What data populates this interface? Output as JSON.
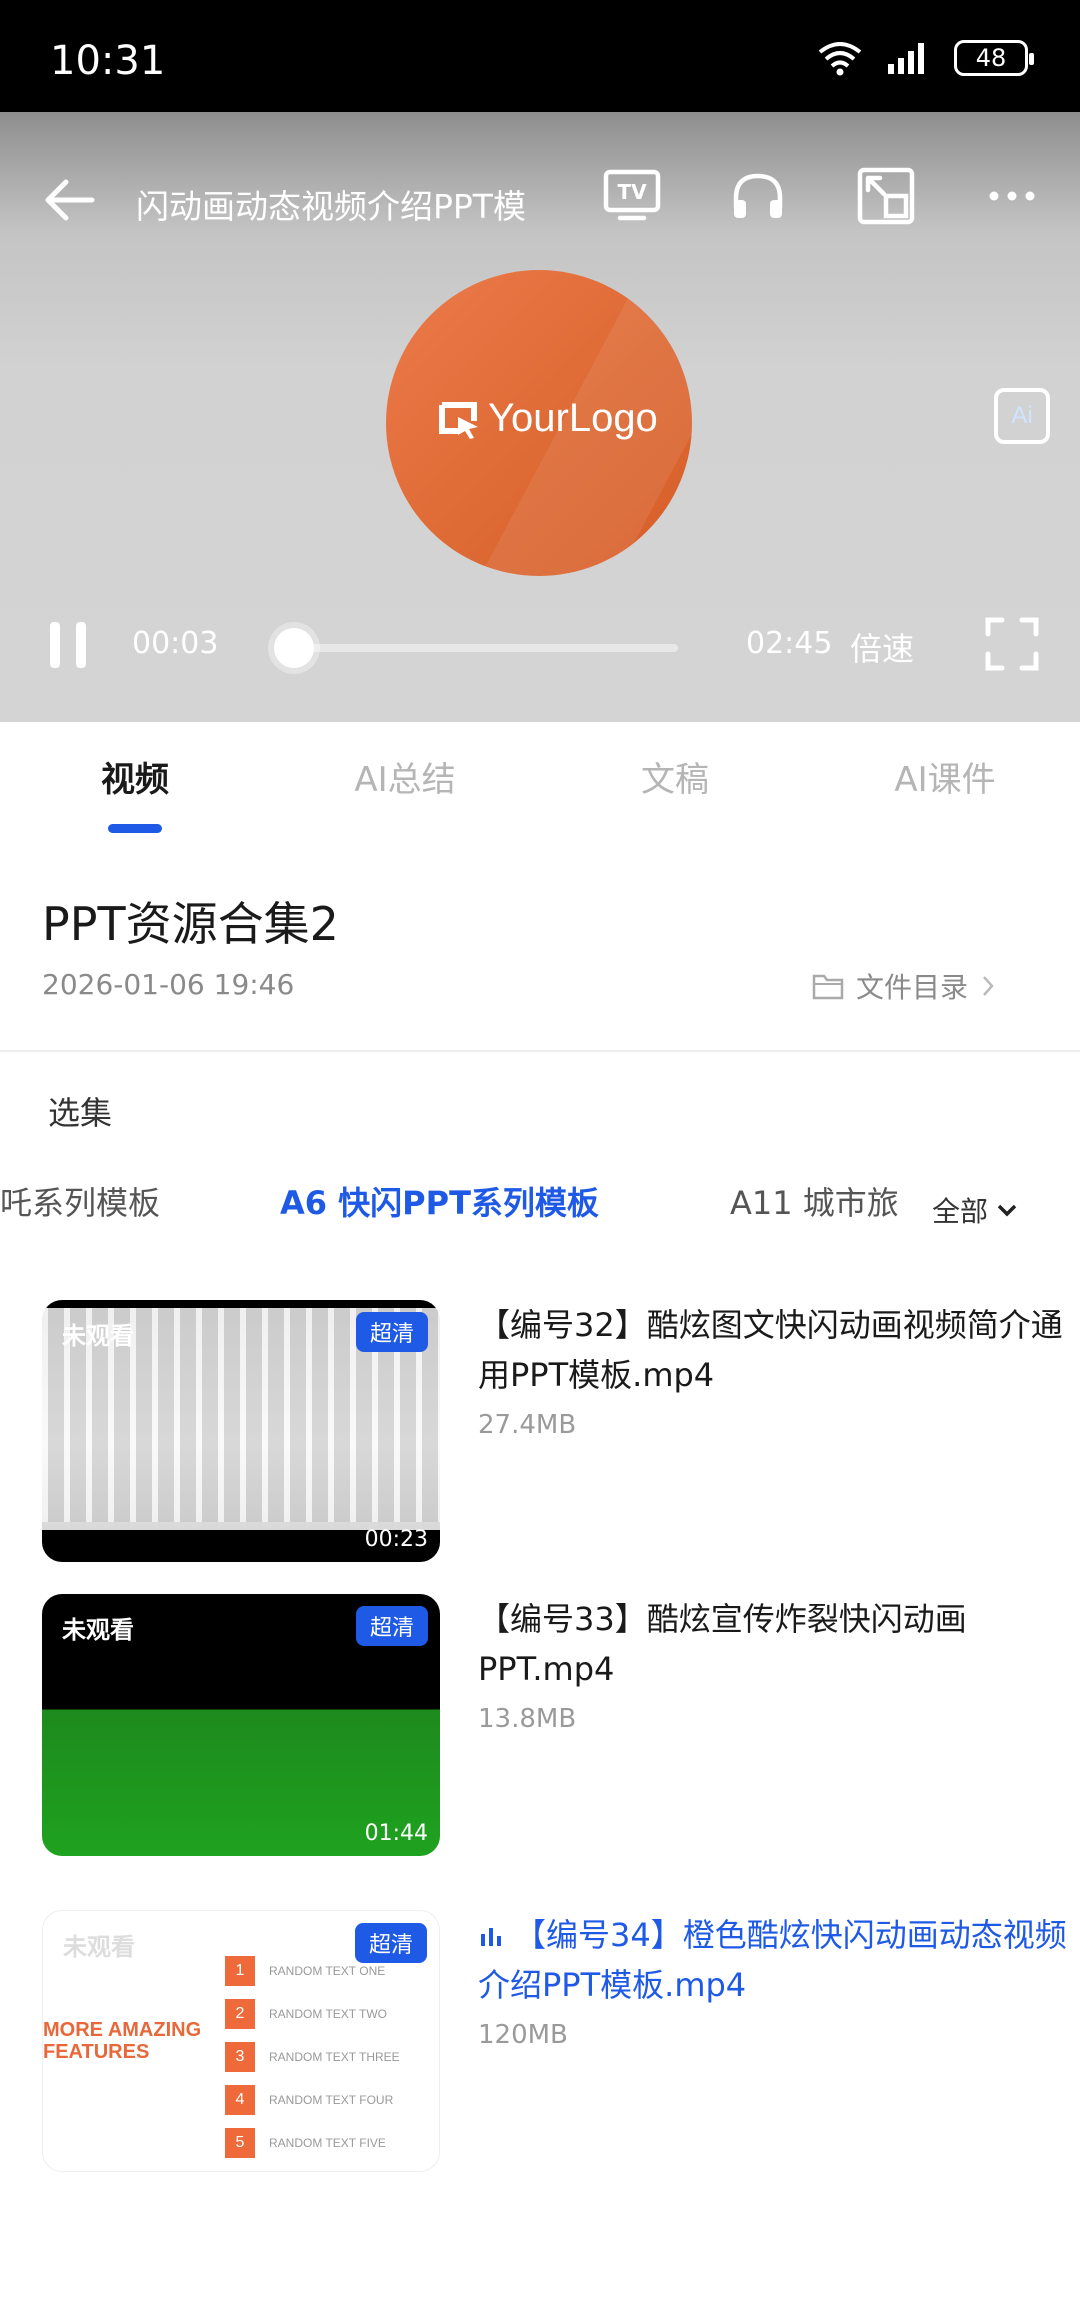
{
  "status_bar": {
    "time": "10:31",
    "battery": "48"
  },
  "player": {
    "title": "闪动画动态视频介绍PPT模",
    "logo_text": "YourLogo",
    "ai_badge": "Ai",
    "current_time": "00:03",
    "total_time": "02:45",
    "progress": 0.018,
    "speed_label": "倍速"
  },
  "tabs": [
    {
      "label": "视频",
      "active": true
    },
    {
      "label": "AI总结",
      "active": false
    },
    {
      "label": "文稿",
      "active": false
    },
    {
      "label": "AI课件",
      "active": false
    }
  ],
  "playlist": {
    "title": "PPT资源合集2",
    "date": "2026-01-06 19:46",
    "dir_label": "文件目录"
  },
  "series": {
    "label": "选集",
    "items": [
      "吒系列模板",
      "A6  快闪PPT系列模板",
      "A11  城市旅"
    ],
    "active_index": 1,
    "all_label": "全部"
  },
  "videos": [
    {
      "title": "【编号32】酷炫图文快闪动画视频简介通用PPT模板.mp4",
      "size": "27.4MB",
      "watch_status": "未观看",
      "quality": "超清",
      "duration": "00:23",
      "playing": false
    },
    {
      "title": "【编号33】酷炫宣传炸裂快闪动画PPT.mp4",
      "size": "13.8MB",
      "watch_status": "未观看",
      "quality": "超清",
      "duration": "01:44",
      "playing": false
    },
    {
      "title": "【编号34】橙色酷炫快闪动画动态视频介绍PPT模板.mp4",
      "size": "120MB",
      "watch_status": "未观看",
      "quality": "超清",
      "duration": "",
      "playing": true
    }
  ],
  "thumb3_slide": {
    "heading": [
      "MORE AMAZING",
      "FEATURES"
    ],
    "rows": [
      {
        "num": "1",
        "text": "RANDOM TEXT ONE"
      },
      {
        "num": "2",
        "text": "RANDOM TEXT TWO"
      },
      {
        "num": "3",
        "text": "RANDOM TEXT THREE"
      },
      {
        "num": "4",
        "text": "RANDOM TEXT FOUR"
      },
      {
        "num": "5",
        "text": "RANDOM TEXT FIVE"
      }
    ]
  },
  "colors": {
    "accent": "#1f5ae6",
    "logo_orange": "#de6a35"
  }
}
